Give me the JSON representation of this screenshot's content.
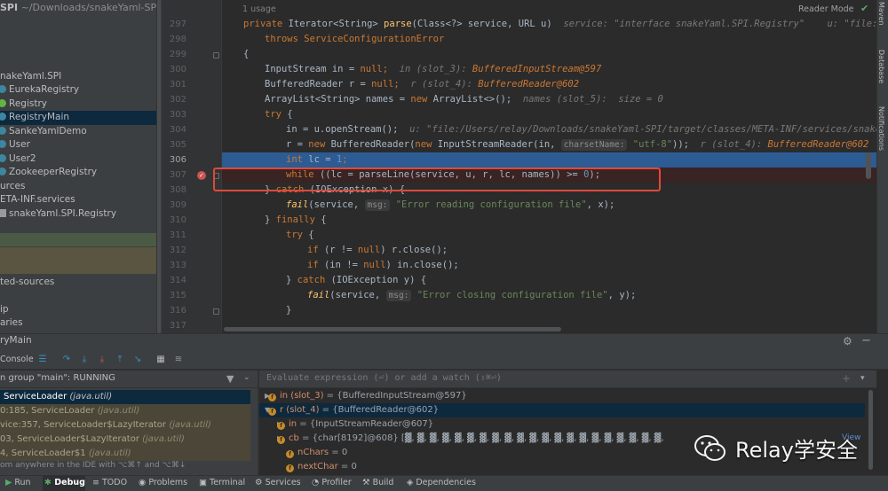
{
  "project": {
    "name": "SPI",
    "path": "~/Downloads/snakeYaml-SPI",
    "items": [
      {
        "label": "nakeYaml.SPI"
      },
      {
        "label": "EurekaRegistry"
      },
      {
        "label": "Registry"
      },
      {
        "label": "RegistryMain"
      },
      {
        "label": "SankeYamlDemo"
      },
      {
        "label": "User"
      },
      {
        "label": "User2"
      },
      {
        "label": "ZookeeperRegistry"
      },
      {
        "label": "urces"
      },
      {
        "label": "ETA-INF.services"
      },
      {
        "label": "snakeYaml.SPI.Registry"
      },
      {
        "label": "ted-sources"
      },
      {
        "label": "ip"
      },
      {
        "label": "aries"
      }
    ]
  },
  "editor": {
    "usage_hint": "1 usage",
    "reader_mode": "Reader Mode",
    "lines": [
      {
        "num": "297"
      },
      {
        "num": "298"
      },
      {
        "num": "299"
      },
      {
        "num": "300"
      },
      {
        "num": "301"
      },
      {
        "num": "302"
      },
      {
        "num": "303"
      },
      {
        "num": "304"
      },
      {
        "num": "305"
      },
      {
        "num": "306"
      },
      {
        "num": "307"
      },
      {
        "num": "308"
      },
      {
        "num": "309"
      },
      {
        "num": "310"
      },
      {
        "num": "311"
      },
      {
        "num": "312"
      },
      {
        "num": "313"
      },
      {
        "num": "314"
      },
      {
        "num": "315"
      },
      {
        "num": "316"
      },
      {
        "num": "317"
      }
    ],
    "code": {
      "l297_a": "private ",
      "l297_b": "Iterator<String> ",
      "l297_c": "parse",
      "l297_d": "(Class<?> service, URL u)",
      "l297_hint": "  service: \"interface snakeYaml.SPI.Registry\"    u: \"file:/Us",
      "l298": "throws ServiceConfigurationError",
      "l299": "{",
      "l300_a": "InputStream in = ",
      "l300_b": "null",
      "l300_c": ";",
      "l300_hint": "  in (slot_3): ",
      "l300_hintv": "BufferedInputStream@597",
      "l301_a": "BufferedReader r = ",
      "l301_b": "null",
      "l301_c": ";",
      "l301_hint": "  r (slot_4): ",
      "l301_hintv": "BufferedReader@602",
      "l302_a": "ArrayList<String> names = ",
      "l302_b": "new ",
      "l302_c": "ArrayList<>();",
      "l302_hint": "  names (slot_5):  size = 0",
      "l303_a": "try ",
      "l303_b": "{",
      "l304_a": "in = u.openStream();",
      "l304_hint": "  u: \"file:/Users/relay/Downloads/snakeYaml-SPI/target/classes/META-INF/services/snakeY",
      "l305_a": "r = ",
      "l305_b": "new ",
      "l305_c": "BufferedReader(",
      "l305_d": "new ",
      "l305_e": "InputStreamReader(in, ",
      "l305_param": "charsetName:",
      "l305_str": " \"utf-8\"",
      "l305_f": "));",
      "l305_hint": "  r (slot_4): ",
      "l305_hintv": "BufferedReader@602",
      "l306_a": "int ",
      "l306_b": "lc = ",
      "l306_c": "1",
      "l306_d": ";",
      "l307_a": "while ",
      "l307_b": "((lc = parseLine(service, u, r, lc, names)) >= ",
      "l307_c": "0",
      "l307_d": ");",
      "l308_a": "} ",
      "l308_b": "catch ",
      "l308_c": "(IOException x) {",
      "l309_a": "fail",
      "l309_b": "(service, ",
      "l309_param": "msg:",
      "l309_str": " \"Error reading configuration file\"",
      "l309_c": ", x);",
      "l310_a": "} ",
      "l310_b": "finally ",
      "l310_c": "{",
      "l311_a": "try ",
      "l311_b": "{",
      "l312_a": "if ",
      "l312_b": "(r != ",
      "l312_c": "null",
      "l312_d": ") r.close();",
      "l313_a": "if ",
      "l313_b": "(in != ",
      "l313_c": "null",
      "l313_d": ") in.close();",
      "l314_a": "} ",
      "l314_b": "catch ",
      "l314_c": "(IOException y) {",
      "l315_a": "fail",
      "l315_b": "(service, ",
      "l315_param": "msg:",
      "l315_str": " \"Error closing configuration file\"",
      "l315_c": ", y);",
      "l316": "}",
      "l317": ""
    }
  },
  "right_strip": {
    "maven": "Maven",
    "database": "Database",
    "notifications": "Notifications"
  },
  "debug": {
    "title": "ryMain",
    "console_tab": "Console",
    "threads_label": "n group \"main\": RUNNING",
    "frames": [
      {
        "name": "ServiceLoader ",
        "loc": "(java.util)"
      },
      {
        "name": "0:185, ServiceLoader ",
        "loc": "(java.util)"
      },
      {
        "name": "vice:357, ServiceLoader$LazyIterator ",
        "loc": "(java.util)"
      },
      {
        "name": "03, ServiceLoader$LazyIterator ",
        "loc": "(java.util)"
      },
      {
        "name": "4, ServiceLoader$1 ",
        "loc": "(java.util)"
      }
    ],
    "frames_hint": "om anywhere in the IDE with ⌥⌘↑ and ⌥⌘↓",
    "eval_placeholder": "Evaluate expression (⏎) or add a watch (⇧⌘⏎)",
    "vars": [
      {
        "name": "in (slot_3)",
        "value": " = {BufferedInputStream@597}"
      },
      {
        "name": "r (slot_4)",
        "value": " = {BufferedReader@602}"
      },
      {
        "name": "in",
        "value": " = {InputStreamReader@607}"
      },
      {
        "name": "cb",
        "value": " = {char[8192]@608} [▓, ▓, ▓, ▓, ▓, ▓, ▓, ▓, ▓, ▓, ▓, ▓, ▓, ▓, ▓, ▓, ▓, ▓, ▓, ▓, ▓,"
      },
      {
        "name": "nChars",
        "value": " = 0"
      },
      {
        "name": "nextChar",
        "value": " = 0"
      }
    ],
    "view_link": "View"
  },
  "bottom_bar": {
    "tabs": [
      "Run",
      "Debug",
      "TODO",
      "Problems",
      "Terminal",
      "Services",
      "Profiler",
      "Build",
      "Dependencies"
    ]
  },
  "watermark": {
    "text": "Relay学安全"
  },
  "colors": {
    "accent": "#2d5b93",
    "breakpoint": "#c75450",
    "highlight_box": "#e0493a",
    "selection": "#0d293e"
  }
}
